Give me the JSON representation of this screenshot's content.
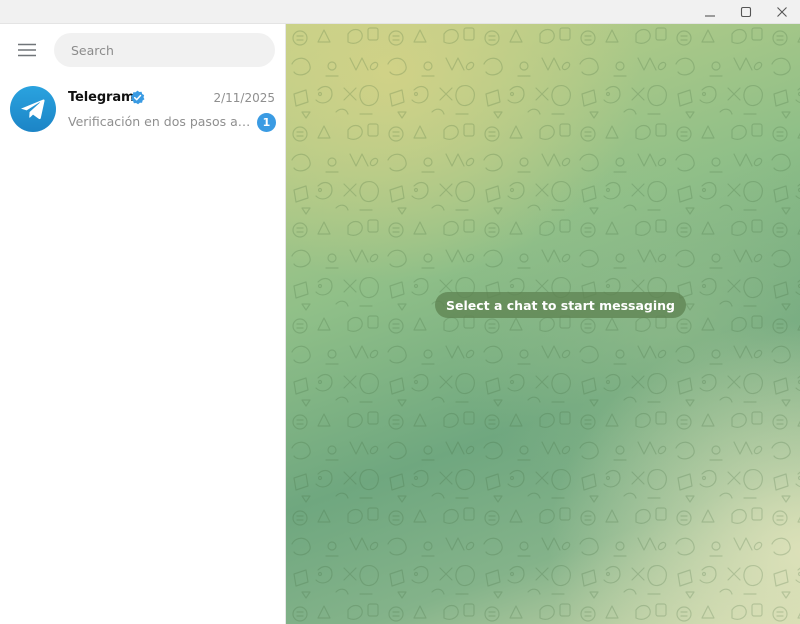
{
  "search": {
    "placeholder": "Search"
  },
  "chats": [
    {
      "name": "Telegram",
      "verified": true,
      "date": "2/11/2025",
      "preview": "Verificación en dos pasos activada",
      "unread": "1",
      "avatar_icon": "telegram-plane-icon"
    }
  ],
  "main": {
    "empty_notice": "Select a chat to start messaging"
  },
  "colors": {
    "accent": "#3a9be3",
    "avatar": "#2a9fda",
    "badge": "#3a9be3",
    "notice_bg": "#5f8452"
  },
  "icons": {
    "menu": "hamburger-menu-icon",
    "minimize": "minimize-icon",
    "maximize": "maximize-icon",
    "close": "close-icon",
    "verified": "verified-badge-icon"
  }
}
